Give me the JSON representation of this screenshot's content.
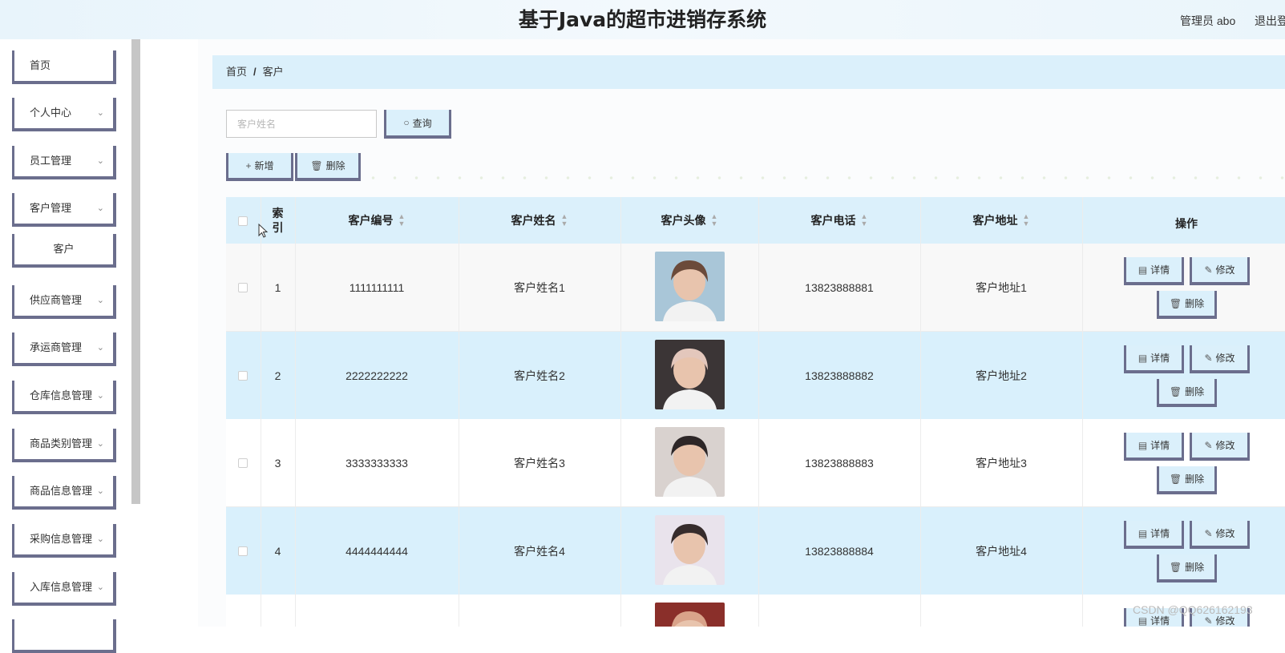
{
  "header": {
    "title": "基于Java的超市进销存系统",
    "user": "管理员 abo",
    "logout": "退出登录"
  },
  "sidebar": {
    "items": [
      {
        "label": "首页",
        "expandable": false
      },
      {
        "label": "个人中心",
        "expandable": true
      },
      {
        "label": "员工管理",
        "expandable": true
      },
      {
        "label": "客户管理",
        "expandable": true
      },
      {
        "label": "客户",
        "expandable": false,
        "sub": true
      },
      {
        "label": "供应商管理",
        "expandable": true
      },
      {
        "label": "承运商管理",
        "expandable": true
      },
      {
        "label": "仓库信息管理",
        "expandable": true
      },
      {
        "label": "商品类别管理",
        "expandable": true
      },
      {
        "label": "商品信息管理",
        "expandable": true
      },
      {
        "label": "采购信息管理",
        "expandable": true
      },
      {
        "label": "入库信息管理",
        "expandable": true
      }
    ]
  },
  "breadcrumb": {
    "home": "首页",
    "separator": "/",
    "current": "客户"
  },
  "search": {
    "placeholder": "客户姓名",
    "button": "查询"
  },
  "toolbar": {
    "add": "新增",
    "delete": "删除"
  },
  "table": {
    "columns": [
      "索引",
      "客户编号",
      "客户姓名",
      "客户头像",
      "客户电话",
      "客户地址",
      "操作"
    ],
    "rows": [
      {
        "index": "1",
        "code": "1111111111",
        "name": "客户姓名1",
        "phone": "13823888881",
        "address": "客户地址1"
      },
      {
        "index": "2",
        "code": "2222222222",
        "name": "客户姓名2",
        "phone": "13823888882",
        "address": "客户地址2"
      },
      {
        "index": "3",
        "code": "3333333333",
        "name": "客户姓名3",
        "phone": "13823888883",
        "address": "客户地址3"
      },
      {
        "index": "4",
        "code": "4444444444",
        "name": "客户姓名4",
        "phone": "13823888884",
        "address": "客户地址4"
      },
      {
        "index": "",
        "code": "",
        "name": "",
        "phone": "",
        "address": ""
      }
    ],
    "actions": {
      "detail": "详情",
      "edit": "修改",
      "delete": "删除"
    }
  },
  "watermark": "CSDN @QQ626162193",
  "colors": {
    "accent": "#dbf0fb",
    "border": "#6b6e8d"
  }
}
